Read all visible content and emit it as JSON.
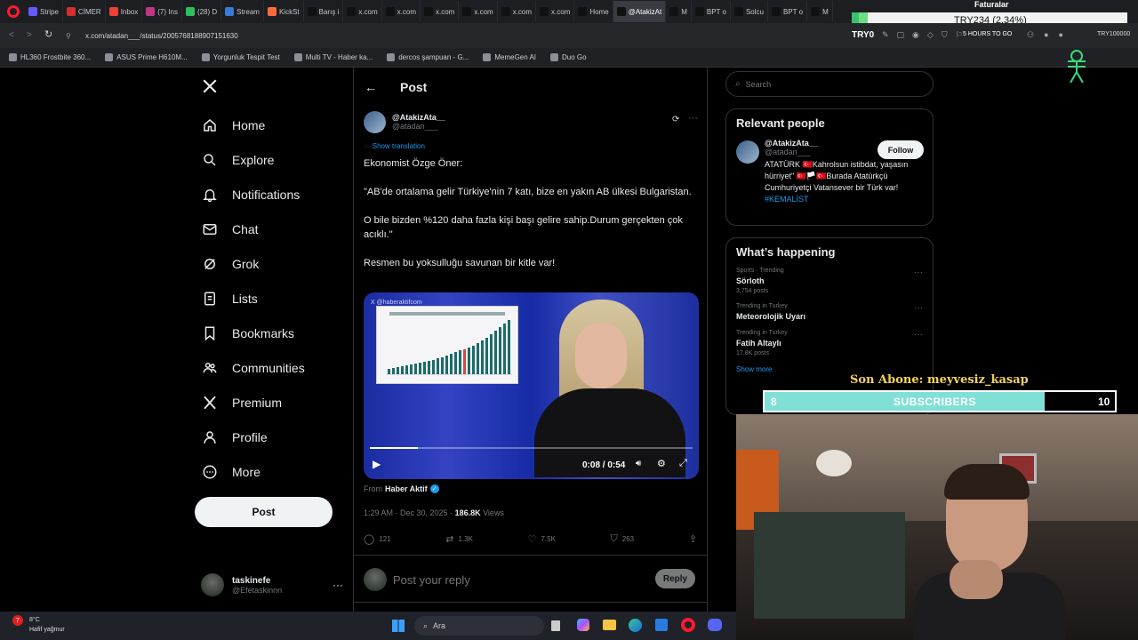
{
  "browser": {
    "tabs": [
      {
        "label": "Stripe",
        "color": "#635bff"
      },
      {
        "label": "CİMER",
        "color": "#d32f2f"
      },
      {
        "label": "Inbox",
        "color": "#ea4335"
      },
      {
        "label": "(7) Ins",
        "color": "#c13584"
      },
      {
        "label": "(28) D",
        "color": "#2dbe60"
      },
      {
        "label": "Stream",
        "color": "#3a7bd5"
      },
      {
        "label": "KickSt",
        "color": "#ff6b3d"
      },
      {
        "label": "Barış i",
        "color": "#111111"
      },
      {
        "label": "x.com",
        "color": "#111111"
      },
      {
        "label": "x.com",
        "color": "#111111"
      },
      {
        "label": "x.com",
        "color": "#111111"
      },
      {
        "label": "x.com",
        "color": "#111111"
      },
      {
        "label": "x.com",
        "color": "#111111"
      },
      {
        "label": "x.com",
        "color": "#111111"
      },
      {
        "label": "Home",
        "color": "#111111"
      },
      {
        "label": "@AtakizAt",
        "color": "#111111"
      },
      {
        "label": "M",
        "color": "#111111"
      },
      {
        "label": "BPT o",
        "color": "#111111"
      },
      {
        "label": "Solcu",
        "color": "#111111"
      },
      {
        "label": "BPT o",
        "color": "#111111"
      },
      {
        "label": "M",
        "color": "#111111"
      }
    ],
    "url": "x.com/atadan___/status/2005768188907151630",
    "bookmarks": [
      "HL360 Frostbite 360...",
      "ASUS Prime H610M...",
      "Yorgunluk Tespit Test",
      "Multi TV - Haber ka...",
      "dercos şampuan - G...",
      "MemeGen AI",
      "Duo Go"
    ],
    "toolbar_right": {
      "logo_text": "TRY0",
      "timer": "5 HOURS TO GO",
      "right_text": "TRY100000"
    }
  },
  "ticker": {
    "title": "Faturalar",
    "value": "TRY234 (2.34%)"
  },
  "nav": {
    "items": [
      {
        "label": "Home",
        "icon": "home-icon"
      },
      {
        "label": "Explore",
        "icon": "search-icon"
      },
      {
        "label": "Notifications",
        "icon": "bell-icon"
      },
      {
        "label": "Chat",
        "icon": "mail-icon"
      },
      {
        "label": "Grok",
        "icon": "grok-icon"
      },
      {
        "label": "Lists",
        "icon": "list-icon"
      },
      {
        "label": "Bookmarks",
        "icon": "bookmark-icon"
      },
      {
        "label": "Communities",
        "icon": "people-icon"
      },
      {
        "label": "Premium",
        "icon": "x-icon"
      },
      {
        "label": "Profile",
        "icon": "person-icon"
      },
      {
        "label": "More",
        "icon": "more-circle-icon"
      }
    ],
    "post_button": "Post",
    "account": {
      "name": "taskinefe",
      "handle": "@Efetaskinnn"
    }
  },
  "post": {
    "header_title": "Post",
    "author_name": "@AtakizAta__",
    "author_handle": "@atadan___",
    "show_translation": "Show translation",
    "paragraphs": [
      "Ekonomist Özge Öner:",
      "\"AB'de ortalama gelir Türkiye'nin 7 katı, bize en yakın AB ülkesi Bulgaristan.",
      "O bile bizden %120 daha fazla kişi başı gelire sahip.Durum gerçekten çok acıklı.\"",
      "Resmen bu yoksulluğu savunan bir kitle var!"
    ],
    "video": {
      "watermark": "X @haberaktifcom",
      "time": "0:08 / 0:54",
      "progress": 0.15
    },
    "from_label": "From",
    "from_source": "Haber Aktif",
    "meta_time": "1:29 AM · Dec 30, 2025 · ",
    "meta_views_count": "186.8K",
    "meta_views_label": " Views",
    "actions": {
      "replies": "121",
      "reposts": "1.3K",
      "likes": "7.5K",
      "bookmarks": "263"
    },
    "reply_placeholder": "Post your reply",
    "reply_button": "Reply"
  },
  "sidebar": {
    "search_placeholder": "Search",
    "relevant_title": "Relevant people",
    "person": {
      "name": "@AtakizAta__",
      "handle": "@atadan___",
      "follow": "Follow",
      "bio": "ATATÜRK 🇹🇷Kahrolsun istibdat, yaşasın hürriyet\" 🇹🇷🏳️🇹🇷Burada Atatürkçü Cumhuriyetçi Vatansever bir Türk var! ",
      "bio_tag": "#KEMALİST"
    },
    "happening_title": "What’s happening",
    "trends": [
      {
        "meta": "Sports · Trending",
        "name": "Sörloth",
        "posts": "3,754 posts"
      },
      {
        "meta": "Trending in Turkey",
        "name": "Meteorolojik Uyarı",
        "posts": ""
      },
      {
        "meta": "Trending in Turkey",
        "name": "Fatih Altaylı",
        "posts": "17.8K posts"
      }
    ],
    "show_more": "Show more"
  },
  "stream": {
    "last_sub": "Son Abone: meyvesiz_kasap",
    "sub_current": "8",
    "sub_label": "SUBSCRIBERS",
    "sub_goal": "10",
    "sub_fraction": 0.8
  },
  "taskbar": {
    "temp": "8°C",
    "weather": "Hafif yağmur",
    "search": "Ara"
  },
  "colors": {
    "accent": "#1d9bf0",
    "bg": "#000000",
    "sub_fill": "#80e0d6",
    "gold": "#f3d35b"
  }
}
